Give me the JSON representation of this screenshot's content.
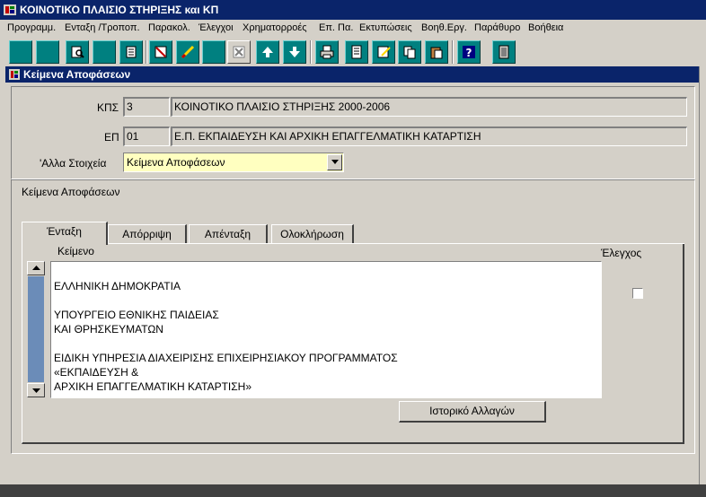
{
  "window": {
    "title": "ΚΟΙΝΟΤΙΚΟ ΠΛΑΙΣΙΟ ΣΤΗΡΙΞΗΣ και ΚΠ"
  },
  "menu": [
    "Προγραμμ.",
    "Ενταξη /Τροποπ.",
    "Παρακολ.",
    "Έλεγχοι",
    "Χρηματορροές",
    "Επ. Πα.",
    "Εκτυπώσεις",
    "Βοηθ.Εργ.",
    "Παράθυρο",
    "Βοήθεια"
  ],
  "toolbar_icons": [
    "save-icon",
    "blank-icon",
    "search-db-icon",
    "blank-icon",
    "database-icon",
    "print-preview-icon",
    "edit-icon",
    "blank-icon",
    "delete-icon",
    "arrow-up-icon",
    "arrow-down-icon",
    "printer-icon",
    "report-icon",
    "edit-doc-icon",
    "copy-icon",
    "paste-icon",
    "help-icon",
    "exit-icon"
  ],
  "subwindow": {
    "title": "Κείμενα Αποφάσεων"
  },
  "form": {
    "kps_label": "ΚΠΣ",
    "kps_code": "3",
    "kps_name": "ΚΟΙΝΟΤΙΚΟ ΠΛΑΙΣΙΟ ΣΤΗΡΙΞΗΣ 2000-2006",
    "ep_label": "ΕΠ",
    "ep_code": "01",
    "ep_name": "Ε.Π. ΕΚΠΑΙΔΕΥΣΗ ΚΑΙ ΑΡΧΙΚΗ ΕΠΑΓΓΕΛΜΑΤΙΚΗ  ΚΑΤΑΡΤΙΣΗ",
    "other_label": "'Αλλα Στοιχεία",
    "other_value": "Κείμενα Αποφάσεων"
  },
  "section": {
    "title": "Κείμενα Αποφάσεων"
  },
  "tabs": [
    "Ένταξη",
    "Απόρριψη",
    "Απένταξη",
    "Ολοκλήρωση"
  ],
  "content": {
    "text_label": "Κείμενο",
    "check_label": "Έλεγχος",
    "lines": [
      "",
      "ΕΛΛΗΝΙΚΗ ΔΗΜΟΚΡΑΤΙΑ",
      "",
      "ΥΠΟΥΡΓΕΙΟ ΕΘΝΙΚΗΣ ΠΑΙΔΕΙΑΣ",
      "ΚΑΙ ΘΡΗΣΚΕΥΜΑΤΩΝ",
      "",
      "ΕΙΔΙΚΗ ΥΠΗΡΕΣΙΑ ΔΙΑΧΕΙΡΙΣΗΣ ΕΠΙΧΕΙΡΗΣΙΑΚΟΥ ΠΡΟΓΡΑΜΜΑΤΟΣ",
      "«ΕΚΠΑΙΔΕΥΣΗ &",
      "ΑΡΧΙΚΗ ΕΠΑΓΓΕΛΜΑΤΙΚΗ ΚΑΤΑΡΤΙΣΗ»"
    ],
    "history_button": "Ιστορικό Αλλαγών"
  },
  "colors": {
    "titlebar": "#0a246a",
    "toolbar_button": "#008080",
    "dropdown_bg": "#ffffc0",
    "window_bg": "#d4d0c8"
  }
}
